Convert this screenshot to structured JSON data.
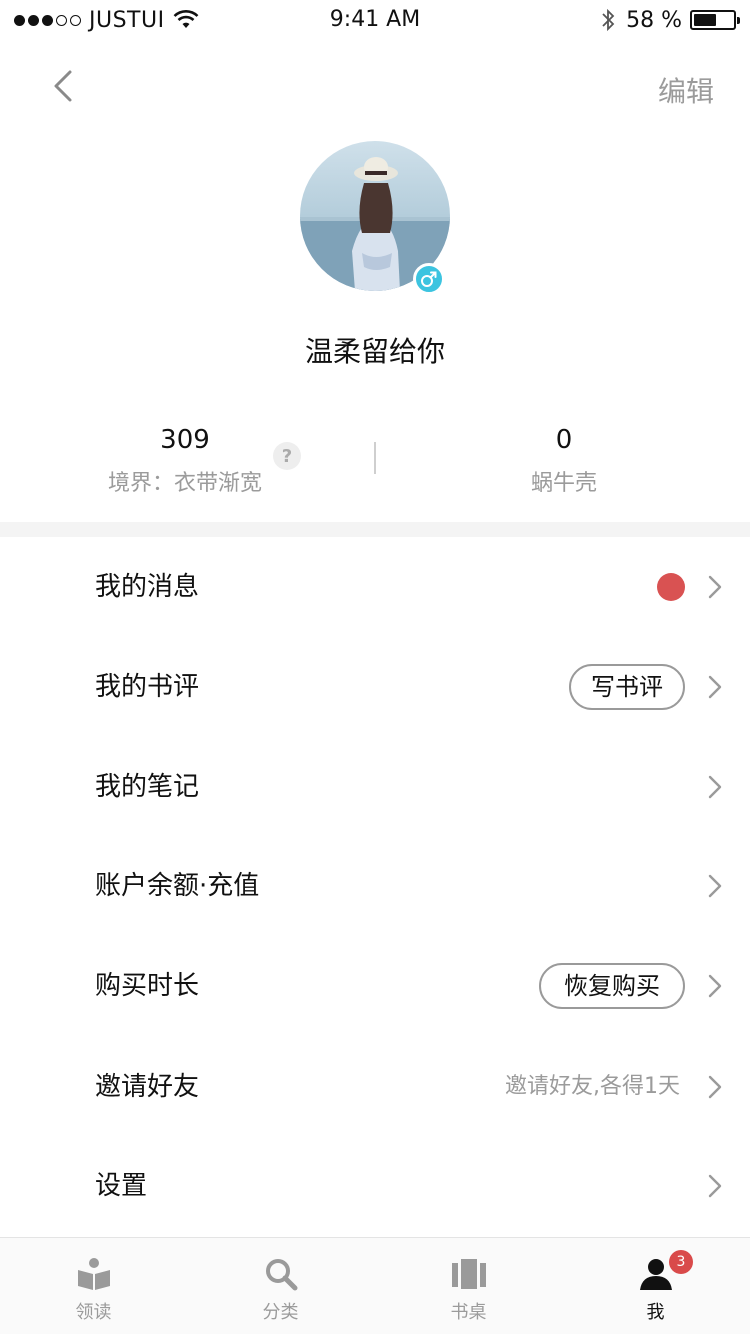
{
  "status_bar": {
    "carrier": "JUSTUI",
    "time": "9:41 AM",
    "battery_percent": "58 %",
    "battery_level": 0.58,
    "signal_bars_filled": 3,
    "signal_bars_total": 5
  },
  "nav": {
    "back_icon": "chevron-left-icon",
    "edit_label": "编辑"
  },
  "profile": {
    "username": "温柔留给你",
    "gender_symbol": "♂",
    "gender_color": "#3cc4e0"
  },
  "stats": {
    "realm_value": "309",
    "realm_label": "境界：衣带渐宽",
    "help_symbol": "?",
    "shell_value": "0",
    "shell_label": "蜗牛壳"
  },
  "menu": {
    "items": [
      {
        "label": "我的消息"
      },
      {
        "label": "我的书评",
        "action": "写书评"
      },
      {
        "label": "我的笔记"
      },
      {
        "label": "账户余额·充值"
      },
      {
        "label": "购买时长",
        "action": "恢复购买"
      },
      {
        "label": "邀请好友",
        "hint": "邀请好友,各得1天"
      },
      {
        "label": "设置"
      }
    ],
    "unread_dot_color": "#d95252"
  },
  "tab_bar": {
    "tabs": [
      {
        "label": "领读",
        "icon": "open-book-icon"
      },
      {
        "label": "分类",
        "icon": "search-icon"
      },
      {
        "label": "书桌",
        "icon": "bookshelf-icon"
      },
      {
        "label": "我",
        "icon": "person-icon",
        "badge": "3",
        "active": true
      }
    ]
  }
}
